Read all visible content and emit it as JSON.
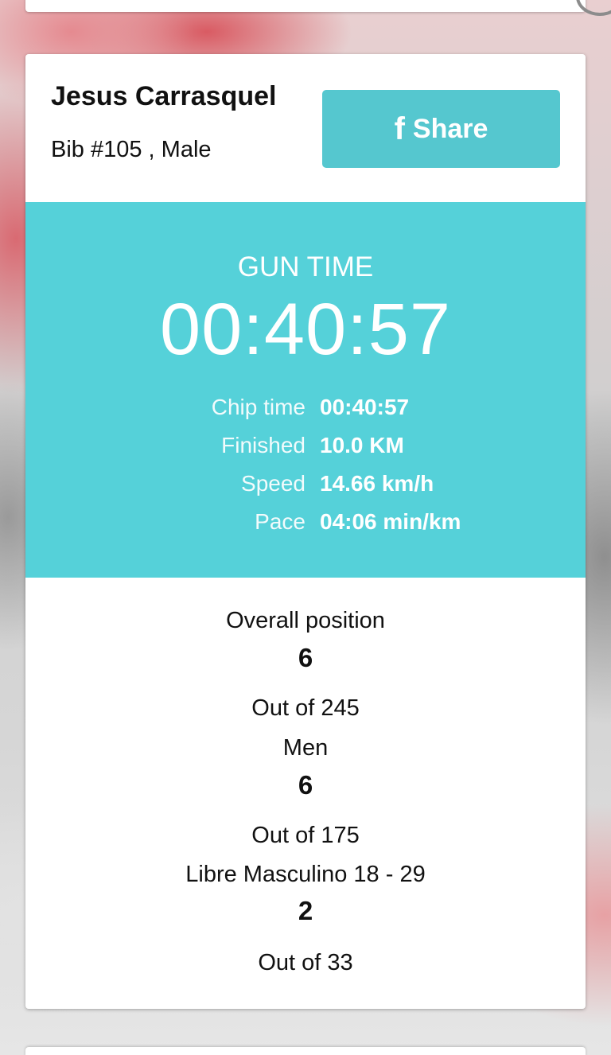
{
  "runner": {
    "name": "Jesus Carrasquel",
    "meta": "Bib #105 , Male"
  },
  "share": {
    "icon": "f",
    "label": "Share"
  },
  "timing": {
    "gun_label": "GUN TIME",
    "gun_time": "00:40:57",
    "stats": [
      {
        "label": "Chip time",
        "value": "00:40:57"
      },
      {
        "label": "Finished",
        "value": "10.0 KM"
      },
      {
        "label": "Speed",
        "value": "14.66 km/h"
      },
      {
        "label": "Pace",
        "value": "04:06 min/km"
      }
    ]
  },
  "positions": [
    {
      "label": "Overall position",
      "value": "6",
      "out_of": "Out of 245"
    },
    {
      "label": "Men",
      "value": "6",
      "out_of": "Out of 175"
    },
    {
      "label": "Libre Masculino 18 - 29",
      "value": "2",
      "out_of": "Out of 33"
    }
  ],
  "colors": {
    "accent": "#55d1d9",
    "share_button": "#55c7cf"
  }
}
